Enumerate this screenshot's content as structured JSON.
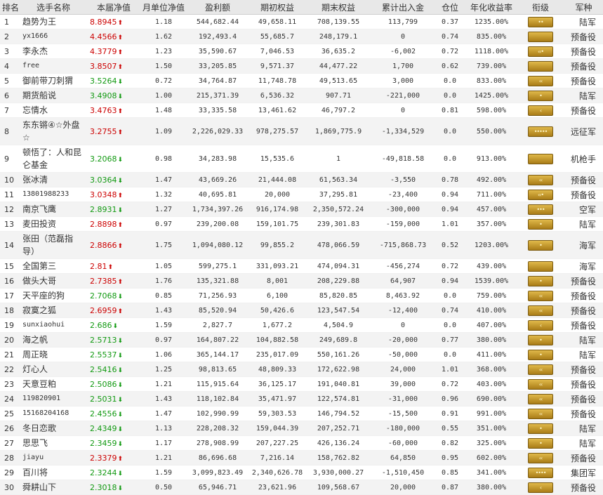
{
  "headers": [
    "排名",
    "选手名称",
    "本届净值",
    "月单位净值",
    "盈利额",
    "期初权益",
    "期末权益",
    "累计出入金",
    "仓位",
    "年化收益率",
    "衔级",
    "军种"
  ],
  "colors": {
    "up": "#cc0000",
    "down": "#119911",
    "badge": "#c99a2e"
  },
  "rows": [
    {
      "rank": "1",
      "name": "趋势为王",
      "nav": "8.8945",
      "dir": "up",
      "mnav": "1.18",
      "profit": "544,682.44",
      "start": "49,658.11",
      "end": "708,139.55",
      "flow": "113,799",
      "pos": "0.37",
      "annual": "1235.00%",
      "badge": "••",
      "army": "陆军"
    },
    {
      "rank": "2",
      "name": "yx1666",
      "nav": "4.4566",
      "dir": "up",
      "mnav": "1.62",
      "profit": "192,493.4",
      "start": "55,685.7",
      "end": "248,179.1",
      "flow": "0",
      "pos": "0.74",
      "annual": "835.00%",
      "badge": "",
      "army": "预备役"
    },
    {
      "rank": "3",
      "name": "李永杰",
      "nav": "4.3779",
      "dir": "up",
      "mnav": "1.23",
      "profit": "35,590.67",
      "start": "7,046.53",
      "end": "36,635.2",
      "flow": "-6,002",
      "pos": "0.72",
      "annual": "1118.00%",
      "badge": "‹‹•",
      "army": "预备役"
    },
    {
      "rank": "4",
      "name": "free",
      "nav": "3.8507",
      "dir": "up",
      "mnav": "1.50",
      "profit": "33,205.85",
      "start": "9,571.37",
      "end": "44,477.22",
      "flow": "1,700",
      "pos": "0.62",
      "annual": "739.00%",
      "badge": "",
      "army": "预备役"
    },
    {
      "rank": "5",
      "name": "御前带刀刺猬",
      "nav": "3.5264",
      "dir": "down",
      "mnav": "0.72",
      "profit": "34,764.87",
      "start": "11,748.78",
      "end": "49,513.65",
      "flow": "3,000",
      "pos": "0.0",
      "annual": "833.00%",
      "badge": "‹‹",
      "army": "预备役"
    },
    {
      "rank": "6",
      "name": "期货船说",
      "nav": "3.4908",
      "dir": "down",
      "mnav": "1.00",
      "profit": "215,371.39",
      "start": "6,536.32",
      "end": "907.71",
      "flow": "-221,000",
      "pos": "0.0",
      "annual": "1425.00%",
      "badge": "•",
      "army": "陆军"
    },
    {
      "rank": "7",
      "name": "忘情水",
      "nav": "3.4763",
      "dir": "up",
      "mnav": "1.48",
      "profit": "33,335.58",
      "start": "13,461.62",
      "end": "46,797.2",
      "flow": "0",
      "pos": "0.81",
      "annual": "598.00%",
      "badge": "‹",
      "army": "预备役"
    },
    {
      "rank": "8",
      "name": "东东锵④☆外盘☆",
      "nav": "3.2755",
      "dir": "up",
      "mnav": "1.09",
      "profit": "2,226,029.33",
      "start": "978,275.57",
      "end": "1,869,775.9",
      "flow": "-1,334,529",
      "pos": "0.0",
      "annual": "550.00%",
      "badge": "•••••",
      "army": "远征军",
      "tall": true
    },
    {
      "rank": "9",
      "name": "顿悟了：人和昆仑基金",
      "nav": "3.2068",
      "dir": "down",
      "mnav": "0.98",
      "profit": "34,283.98",
      "start": "15,535.6",
      "end": "1",
      "flow": "-49,818.58",
      "pos": "0.0",
      "annual": "913.00%",
      "badge": "",
      "army": "机枪手",
      "tall": true
    },
    {
      "rank": "10",
      "name": "张冰清",
      "nav": "3.0364",
      "dir": "down",
      "mnav": "1.47",
      "profit": "43,669.26",
      "start": "21,444.08",
      "end": "61,563.34",
      "flow": "-3,550",
      "pos": "0.78",
      "annual": "492.00%",
      "badge": "‹‹",
      "army": "预备役"
    },
    {
      "rank": "11",
      "name": "13801988233",
      "nav": "3.0348",
      "dir": "up",
      "mnav": "1.32",
      "profit": "40,695.81",
      "start": "20,000",
      "end": "37,295.81",
      "flow": "-23,400",
      "pos": "0.94",
      "annual": "711.00%",
      "badge": "‹‹•",
      "army": "预备役"
    },
    {
      "rank": "12",
      "name": "南京飞鹰",
      "nav": "2.8931",
      "dir": "down",
      "mnav": "1.27",
      "profit": "1,734,397.26",
      "start": "916,174.98",
      "end": "2,350,572.24",
      "flow": "-300,000",
      "pos": "0.94",
      "annual": "457.00%",
      "badge": "•••",
      "army": "空军"
    },
    {
      "rank": "13",
      "name": "麦田投资",
      "nav": "2.8898",
      "dir": "up",
      "mnav": "0.97",
      "profit": "239,200.08",
      "start": "159,101.75",
      "end": "239,301.83",
      "flow": "-159,000",
      "pos": "1.01",
      "annual": "357.00%",
      "badge": "•",
      "army": "陆军"
    },
    {
      "rank": "14",
      "name": "张田（范磊指导）",
      "nav": "2.8866",
      "dir": "up",
      "mnav": "1.75",
      "profit": "1,094,080.12",
      "start": "99,855.2",
      "end": "478,066.59",
      "flow": "-715,868.73",
      "pos": "0.52",
      "annual": "1203.00%",
      "badge": "•",
      "army": "海军",
      "tall": true
    },
    {
      "rank": "15",
      "name": "全国第三",
      "nav": "2.81",
      "dir": "up",
      "mnav": "1.05",
      "profit": "599,275.1",
      "start": "331,093.21",
      "end": "474,094.31",
      "flow": "-456,274",
      "pos": "0.72",
      "annual": "439.00%",
      "badge": "",
      "army": "海军"
    },
    {
      "rank": "16",
      "name": "做头大哥",
      "nav": "2.7385",
      "dir": "up",
      "mnav": "1.76",
      "profit": "135,321.88",
      "start": "8,001",
      "end": "208,229.88",
      "flow": "64,907",
      "pos": "0.94",
      "annual": "1539.00%",
      "badge": "•",
      "army": "预备役"
    },
    {
      "rank": "17",
      "name": "天平座的狗",
      "nav": "2.7068",
      "dir": "down",
      "mnav": "0.85",
      "profit": "71,256.93",
      "start": "6,100",
      "end": "85,820.85",
      "flow": "8,463.92",
      "pos": "0.0",
      "annual": "759.00%",
      "badge": "‹‹",
      "army": "预备役"
    },
    {
      "rank": "18",
      "name": "寂寞之狐",
      "nav": "2.6959",
      "dir": "up",
      "mnav": "1.43",
      "profit": "85,520.94",
      "start": "50,426.6",
      "end": "123,547.54",
      "flow": "-12,400",
      "pos": "0.74",
      "annual": "410.00%",
      "badge": "‹‹",
      "army": "预备役"
    },
    {
      "rank": "19",
      "name": "sunxiaohui",
      "nav": "2.686",
      "dir": "down",
      "mnav": "1.59",
      "profit": "2,827.7",
      "start": "1,677.2",
      "end": "4,504.9",
      "flow": "0",
      "pos": "0.0",
      "annual": "407.00%",
      "badge": "‹",
      "army": "预备役"
    },
    {
      "rank": "20",
      "name": "海之帆",
      "nav": "2.5713",
      "dir": "down",
      "mnav": "0.97",
      "profit": "164,807.22",
      "start": "104,882.58",
      "end": "249,689.8",
      "flow": "-20,000",
      "pos": "0.77",
      "annual": "380.00%",
      "badge": "•",
      "army": "陆军"
    },
    {
      "rank": "21",
      "name": "周正晓",
      "nav": "2.5537",
      "dir": "down",
      "mnav": "1.06",
      "profit": "365,144.17",
      "start": "235,017.09",
      "end": "550,161.26",
      "flow": "-50,000",
      "pos": "0.0",
      "annual": "411.00%",
      "badge": "•",
      "army": "陆军"
    },
    {
      "rank": "22",
      "name": "灯心人",
      "nav": "2.5416",
      "dir": "down",
      "mnav": "1.25",
      "profit": "98,813.65",
      "start": "48,809.33",
      "end": "172,622.98",
      "flow": "24,000",
      "pos": "1.01",
      "annual": "368.00%",
      "badge": "‹‹",
      "army": "预备役"
    },
    {
      "rank": "23",
      "name": "天意豆粕",
      "nav": "2.5086",
      "dir": "down",
      "mnav": "1.21",
      "profit": "115,915.64",
      "start": "36,125.17",
      "end": "191,040.81",
      "flow": "39,000",
      "pos": "0.72",
      "annual": "403.00%",
      "badge": "‹‹",
      "army": "预备役"
    },
    {
      "rank": "24",
      "name": "119820901",
      "nav": "2.5031",
      "dir": "down",
      "mnav": "1.43",
      "profit": "118,102.84",
      "start": "35,471.97",
      "end": "122,574.81",
      "flow": "-31,000",
      "pos": "0.96",
      "annual": "690.00%",
      "badge": "‹‹",
      "army": "预备役"
    },
    {
      "rank": "25",
      "name": "15168204168",
      "nav": "2.4556",
      "dir": "down",
      "mnav": "1.47",
      "profit": "102,990.99",
      "start": "59,303.53",
      "end": "146,794.52",
      "flow": "-15,500",
      "pos": "0.91",
      "annual": "991.00%",
      "badge": "‹‹",
      "army": "预备役"
    },
    {
      "rank": "26",
      "name": "冬日恋歌",
      "nav": "2.4349",
      "dir": "down",
      "mnav": "1.13",
      "profit": "228,208.32",
      "start": "159,044.39",
      "end": "207,252.71",
      "flow": "-180,000",
      "pos": "0.55",
      "annual": "351.00%",
      "badge": "•",
      "army": "陆军"
    },
    {
      "rank": "27",
      "name": "思思飞",
      "nav": "2.3459",
      "dir": "down",
      "mnav": "1.17",
      "profit": "278,908.99",
      "start": "207,227.25",
      "end": "426,136.24",
      "flow": "-60,000",
      "pos": "0.82",
      "annual": "325.00%",
      "badge": "•",
      "army": "陆军"
    },
    {
      "rank": "28",
      "name": "jiayu",
      "nav": "2.3379",
      "dir": "up",
      "mnav": "1.21",
      "profit": "86,696.68",
      "start": "7,216.14",
      "end": "158,762.82",
      "flow": "64,850",
      "pos": "0.95",
      "annual": "602.00%",
      "badge": "‹‹",
      "army": "预备役"
    },
    {
      "rank": "29",
      "name": "百川将",
      "nav": "2.3244",
      "dir": "down",
      "mnav": "1.59",
      "profit": "3,099,823.49",
      "start": "2,340,626.78",
      "end": "3,930,000.27",
      "flow": "-1,510,450",
      "pos": "0.85",
      "annual": "341.00%",
      "badge": "••••",
      "army": "集团军"
    },
    {
      "rank": "30",
      "name": "舜耕山下",
      "nav": "2.3018",
      "dir": "down",
      "mnav": "0.50",
      "profit": "65,946.71",
      "start": "23,621.96",
      "end": "109,568.67",
      "flow": "20,000",
      "pos": "0.87",
      "annual": "380.00%",
      "badge": "‹",
      "army": "预备役"
    }
  ]
}
